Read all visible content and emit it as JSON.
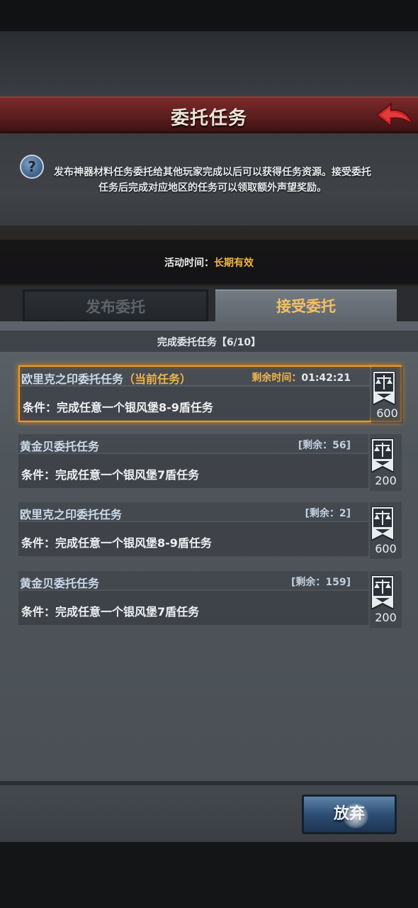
{
  "header": {
    "title": "委托任务"
  },
  "info": {
    "description": "发布神器材料任务委托给其他玩家完成以后可以获得任务资源。接受委托任务后完成对应地区的任务可以领取额外声望奖励。",
    "activity_label": "活动时间：",
    "activity_value": "长期有效"
  },
  "tabs": [
    {
      "label": "发布委托",
      "active": false
    },
    {
      "label": "接受委托",
      "active": true
    }
  ],
  "progress": "完成委托任务【6/10】",
  "tasks": [
    {
      "name": "欧里克之印委托任务",
      "current_tag": "（当前任务）",
      "timer_label": "剩余时间：",
      "timer_value": "01:42:21",
      "condition": "条件：完成任意一个银风堡8-9盾任务",
      "reward": "600"
    },
    {
      "name": "黄金贝委托任务",
      "remain": "[剩余：56]",
      "condition": "条件：完成任意一个银风堡7盾任务",
      "reward": "200"
    },
    {
      "name": "欧里克之印委托任务",
      "remain": "[剩余：2]",
      "condition": "条件：完成任意一个银风堡8-9盾任务",
      "reward": "600"
    },
    {
      "name": "黄金贝委托任务",
      "remain": "[剩余：159]",
      "condition": "条件：完成任意一个银风堡7盾任务",
      "reward": "200"
    }
  ],
  "abandon_label": "放弃",
  "colors": {
    "accent": "#f0b24a",
    "header_red": "#6b2323",
    "current_border": "#f39a1e"
  },
  "icons": {
    "help": "question-icon",
    "back": "red-arrow-back-icon",
    "reward": "scales-banner-icon"
  }
}
